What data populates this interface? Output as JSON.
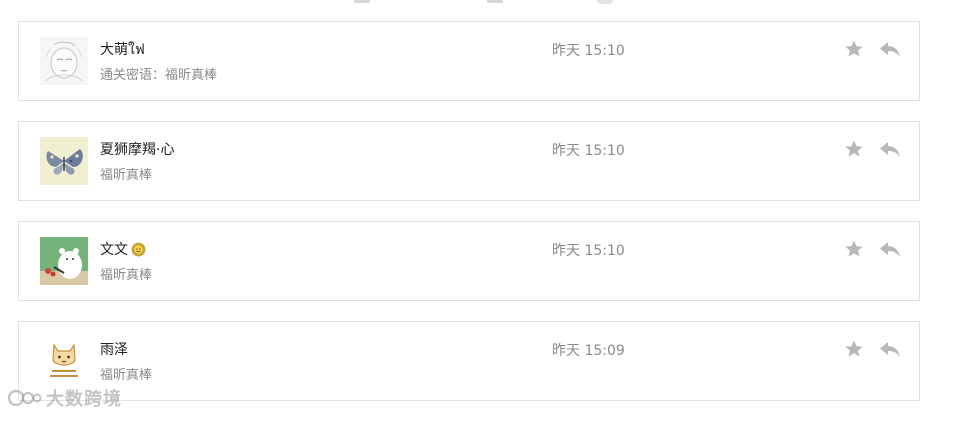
{
  "messages": [
    {
      "name": "大萌ใฟ",
      "emoji": "",
      "text": "通关密语：福昕真棒",
      "time": "昨天 15:10",
      "avatar": "sketch-baby-avatar"
    },
    {
      "name": "夏狮摩羯·心",
      "emoji": "",
      "text": "福昕真棒",
      "time": "昨天 15:10",
      "avatar": "butterfly-avatar"
    },
    {
      "name": "文文",
      "emoji": "sun-emoji",
      "text": "福昕真棒",
      "time": "昨天 15:10",
      "avatar": "cartoon-bear-avatar"
    },
    {
      "name": "雨泽",
      "emoji": "",
      "text": "福昕真棒",
      "time": "昨天 15:09",
      "avatar": "cat-logo-avatar"
    }
  ],
  "actions": {
    "star_icon": "star-icon",
    "reply_icon": "reply-icon"
  },
  "watermark": {
    "text": "大数跨境",
    "logo": "watermark-logo"
  },
  "colors": {
    "border": "#e2e2e2",
    "name": "#222222",
    "muted": "#8a8a8a",
    "icon": "#b8b8b8"
  }
}
